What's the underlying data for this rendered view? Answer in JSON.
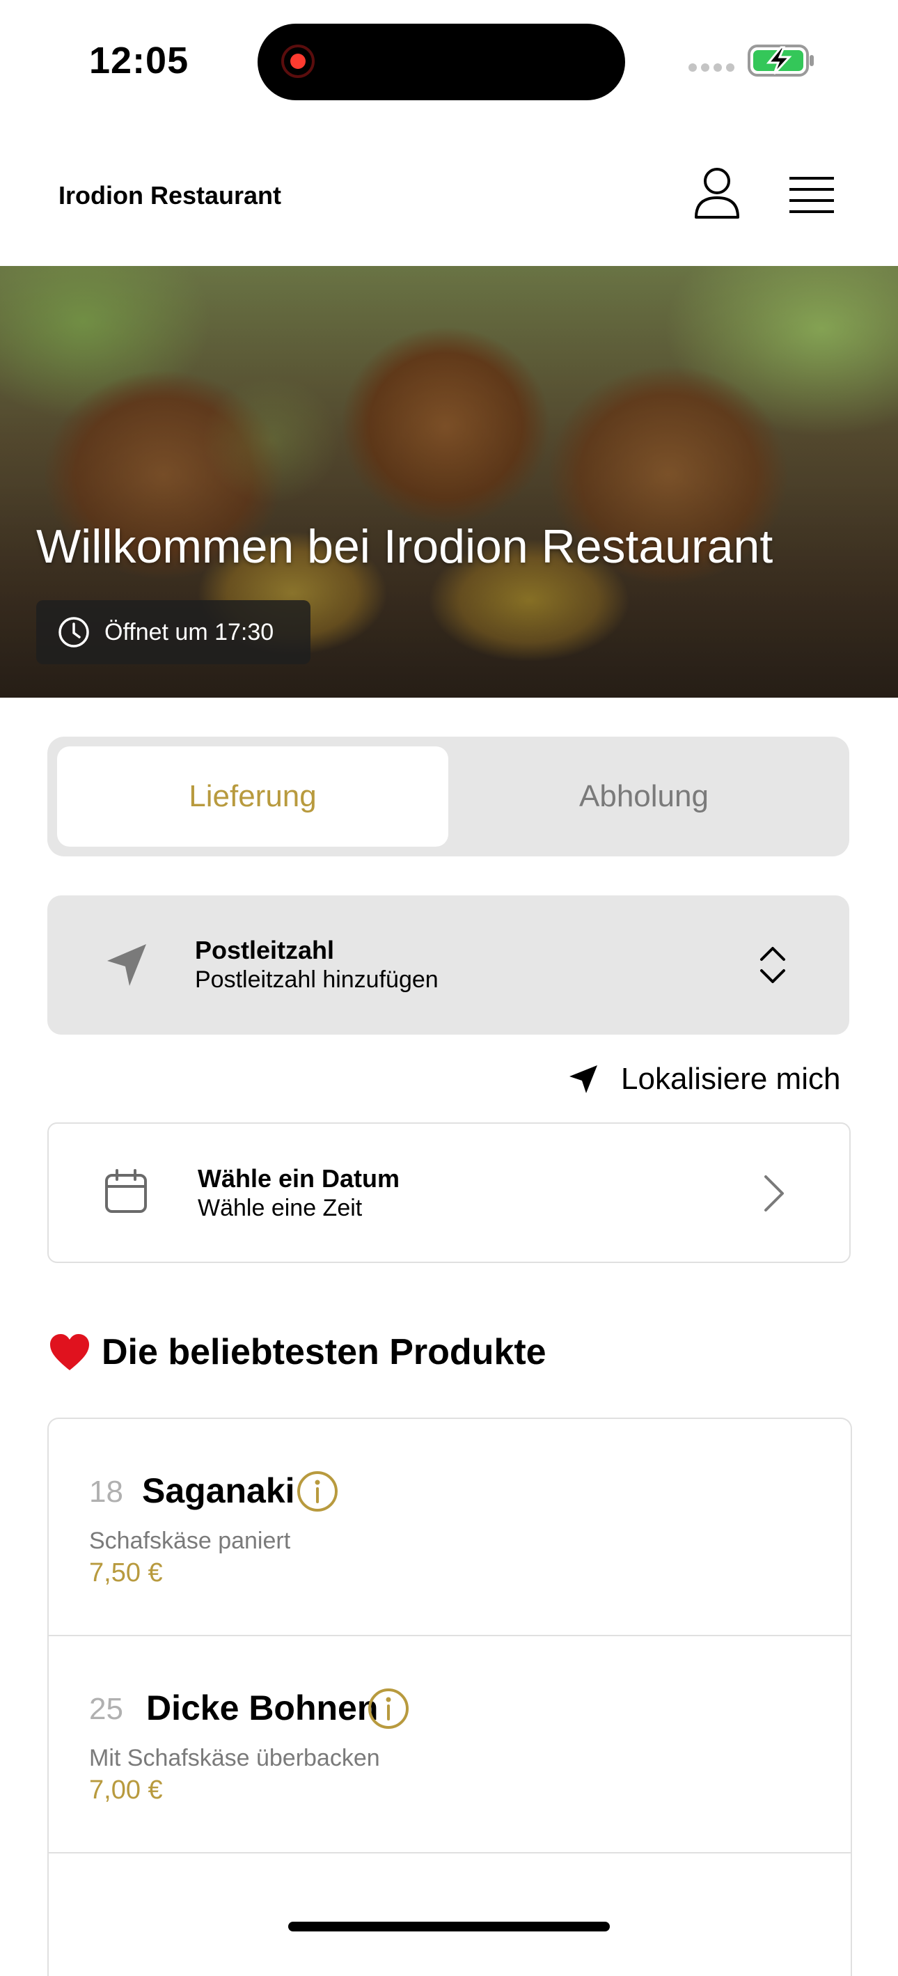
{
  "status_bar": {
    "time": "12:05"
  },
  "header": {
    "brand": "Irodion Restaurant"
  },
  "hero": {
    "title": "Willkommen bei Irodion Restaurant",
    "opening_text": "Öffnet um 17:30"
  },
  "order_mode": {
    "tabs": [
      {
        "label": "Lieferung",
        "active": true
      },
      {
        "label": "Abholung",
        "active": false
      }
    ]
  },
  "postcode": {
    "title": "Postleitzahl",
    "placeholder": "Postleitzahl hinzufügen"
  },
  "locate_me": {
    "label": "Lokalisiere mich"
  },
  "date_picker": {
    "title": "Wähle ein Datum",
    "subtitle": "Wähle eine Zeit"
  },
  "popular": {
    "title": "Die beliebtesten Produkte",
    "products": [
      {
        "number": "18",
        "name": "Saganaki",
        "description": "Schafskäse paniert",
        "price": "7,50 €"
      },
      {
        "number": "25",
        "name": "Dicke Bohnen",
        "description": "Mit Schafskäse überbacken",
        "price": "7,00 €"
      }
    ]
  },
  "colors": {
    "accent_gold": "#b89a3e",
    "segmented_bg": "#e6e6e6",
    "battery_green": "#34c759",
    "recording_red": "#ff3b30",
    "heart_red": "#e0121e"
  }
}
